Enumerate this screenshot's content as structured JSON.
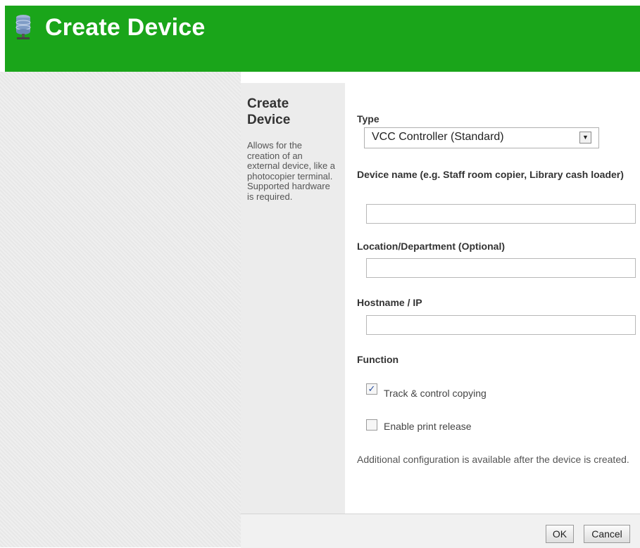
{
  "header": {
    "title": "Create Device",
    "icon": "database-icon"
  },
  "sidebar": {
    "title": "Create Device",
    "description": "Allows for the creation of an external device, like a photocopier terminal. Supported hardware is required."
  },
  "form": {
    "type_label": "Type",
    "type_value": "VCC Controller (Standard)",
    "device_name_label": "Device name (e.g. Staff room copier, Library cash loader)",
    "device_name_value": "",
    "location_label": "Location/Department (Optional)",
    "location_value": "",
    "hostname_label": "Hostname / IP",
    "hostname_value": "",
    "function_label": "Function",
    "track_copying_label": "Track & control copying",
    "track_copying_checked": true,
    "print_release_label": "Enable print release",
    "print_release_checked": false,
    "note": "Additional configuration is available after the device is created."
  },
  "footer": {
    "ok_label": "OK",
    "cancel_label": "Cancel"
  },
  "colors": {
    "header_bg": "#1aa51a",
    "header_text": "#ffffff"
  }
}
